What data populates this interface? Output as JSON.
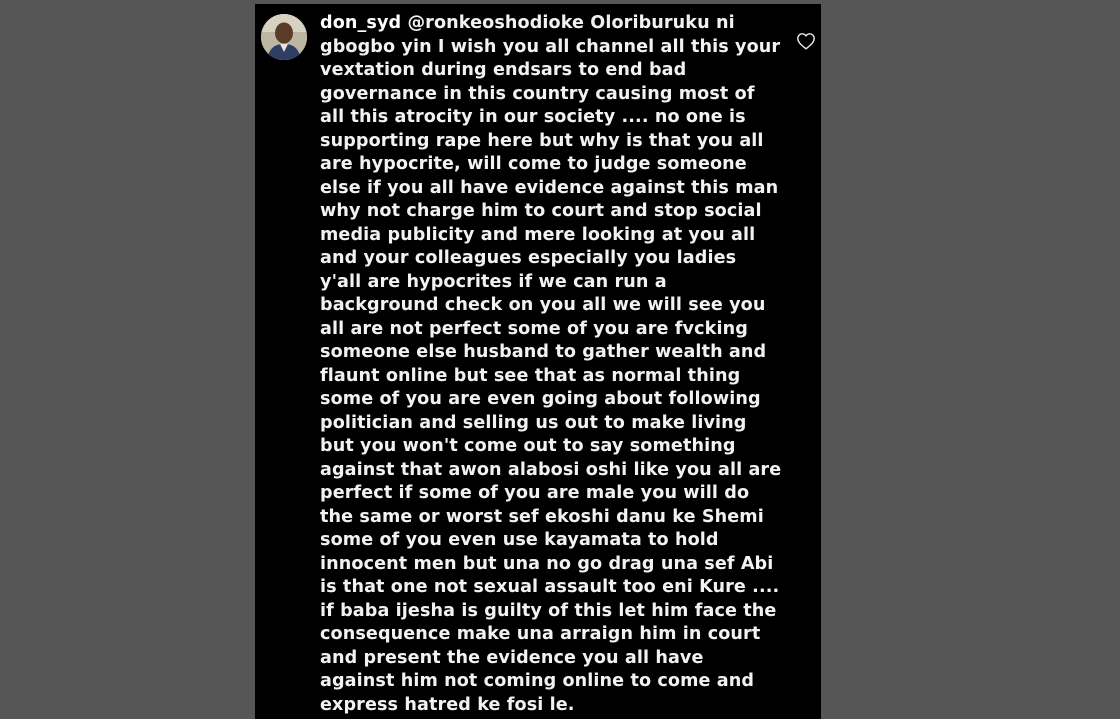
{
  "comment": {
    "username": "don_syd",
    "mention": "@ronkeoshodioke",
    "first_line_rest": " Oloriburuku ni",
    "lines": [
      "gbogbo yin I wish you all channel all this your",
      "vextation during endsars to end bad",
      "governance in this country causing most of",
      "all this atrocity in our society .... no one is",
      "supporting rape here but why is that you all",
      "are hypocrite, will come to judge someone",
      "else if you all have evidence against this man",
      "why not charge him to court and stop social",
      "media publicity and mere looking at you all",
      "and your colleagues especially you ladies",
      "y'all are hypocrites if we can run a",
      "background check on you all we will see you",
      "all are not perfect some of you are fvcking",
      "someone else husband to gather wealth and",
      "flaunt online but see that as normal thing",
      "some of you are even going about following",
      "politician and selling us out to make living",
      "but you won't come out to say something",
      "against that awon alabosi oshi like you all are",
      "perfect if some of you are male you will do",
      "the same or worst sef ekoshi danu ke Shemi",
      "some of you even use kayamata to hold",
      "innocent men but una no go drag una sef Abi",
      "is that one not sexual assault too eni Kure ....",
      "if baba ijesha is guilty of this let him face the",
      "consequence make una arraign him in court",
      "and present the evidence you all have",
      "against him not coming online to come and",
      "express hatred ke fosi le."
    ]
  },
  "icons": {
    "avatar": "profile-photo",
    "like": "heart-outline-icon"
  },
  "colors": {
    "background": "#565656",
    "panel": "#000000",
    "text": "#f2f2f2"
  }
}
